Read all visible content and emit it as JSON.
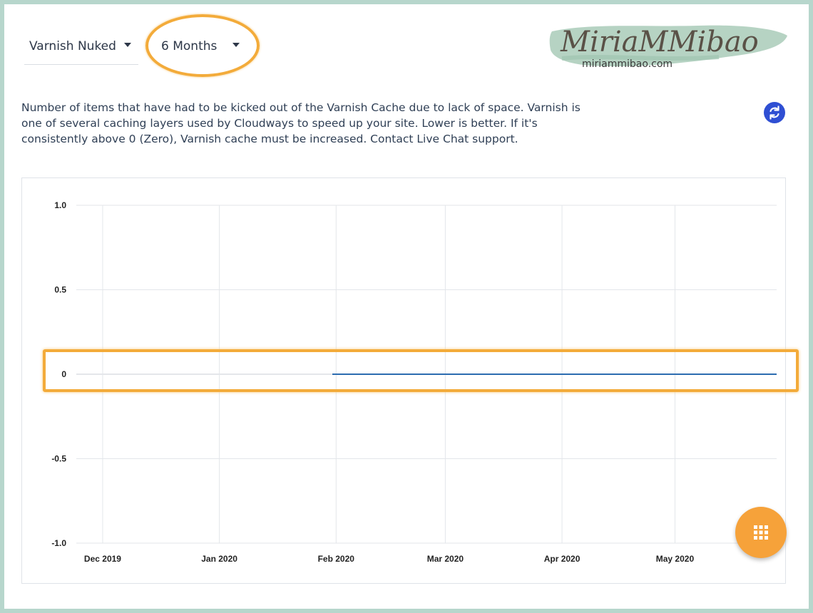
{
  "metric_select": {
    "value": "Varnish Nuked"
  },
  "range_select": {
    "value": "6 Months"
  },
  "watermark": {
    "title": "MiriaMMibao",
    "url": "miriammibao.com"
  },
  "description": "Number of items that have had to be kicked out of the Varnish Cache due to lack of space. Varnish is one of several caching layers used by Cloudways to speed up your site. Lower is better. If it's consistently above 0 (Zero), Varnish cache must be increased. Contact Live Chat support.",
  "icons": {
    "refresh": "refresh-icon",
    "fab": "grid-menu-icon"
  },
  "colors": {
    "accent": "#f3ab3a",
    "series": "#2b6cb0",
    "refresh": "#2f4fd3",
    "fab": "#f6a23a"
  },
  "chart_data": {
    "type": "line",
    "x_tick_labels": [
      "Dec 2019",
      "Jan 2020",
      "Feb 2020",
      "Mar 2020",
      "Apr 2020",
      "May 2020"
    ],
    "y_tick_labels": [
      "1.0",
      "0.5",
      "0",
      "-0.5",
      "-1.0"
    ],
    "ylim": [
      -1.0,
      1.0
    ],
    "xlim": [
      "2019-11-24",
      "2020-05-28"
    ],
    "grid": true,
    "series": [
      {
        "points": [
          {
            "x": "2020-01-31",
            "y": 0
          },
          {
            "x": "2020-05-28",
            "y": 0
          }
        ]
      }
    ]
  }
}
